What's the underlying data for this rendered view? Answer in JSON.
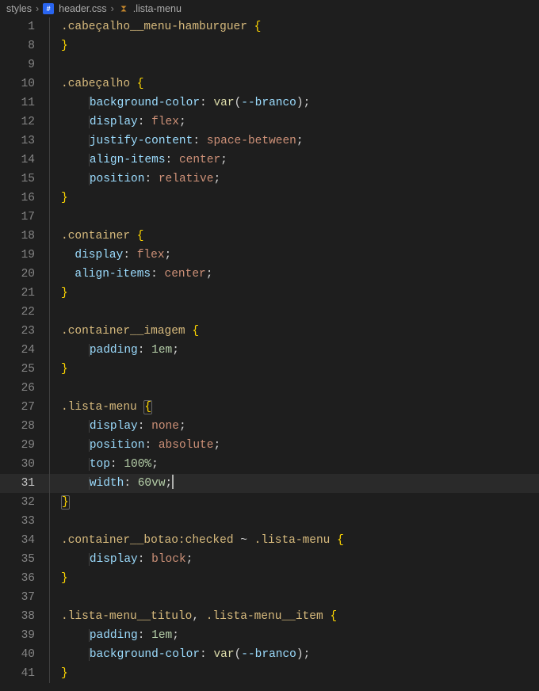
{
  "breadcrumb": {
    "folder": "styles",
    "file": "header.css",
    "symbol": ".lista-menu"
  },
  "lines": [
    {
      "num": "1",
      "indent": 0,
      "tokens": [
        [
          "sel",
          ".cabeçalho__menu-hamburguer"
        ],
        [
          "sp",
          " "
        ],
        [
          "brace",
          "{"
        ]
      ]
    },
    {
      "num": "8",
      "indent": 0,
      "tokens": [
        [
          "brace",
          "}"
        ]
      ]
    },
    {
      "num": "9",
      "indent": 0,
      "tokens": []
    },
    {
      "num": "10",
      "indent": 0,
      "tokens": [
        [
          "sel",
          ".cabeçalho"
        ],
        [
          "sp",
          " "
        ],
        [
          "brace",
          "{"
        ]
      ]
    },
    {
      "num": "11",
      "indent": 1,
      "tokens": [
        [
          "prop",
          "background-color"
        ],
        [
          "punc",
          ":"
        ],
        [
          "sp",
          " "
        ],
        [
          "func",
          "var"
        ],
        [
          "punc",
          "("
        ],
        [
          "var",
          "--branco"
        ],
        [
          "punc",
          ")"
        ],
        [
          "punc",
          ";"
        ]
      ]
    },
    {
      "num": "12",
      "indent": 1,
      "tokens": [
        [
          "prop",
          "display"
        ],
        [
          "punc",
          ":"
        ],
        [
          "sp",
          " "
        ],
        [
          "val",
          "flex"
        ],
        [
          "punc",
          ";"
        ]
      ]
    },
    {
      "num": "13",
      "indent": 1,
      "tokens": [
        [
          "prop",
          "justify-content"
        ],
        [
          "punc",
          ":"
        ],
        [
          "sp",
          " "
        ],
        [
          "val",
          "space-between"
        ],
        [
          "punc",
          ";"
        ]
      ]
    },
    {
      "num": "14",
      "indent": 1,
      "tokens": [
        [
          "prop",
          "align-items"
        ],
        [
          "punc",
          ":"
        ],
        [
          "sp",
          " "
        ],
        [
          "val",
          "center"
        ],
        [
          "punc",
          ";"
        ]
      ]
    },
    {
      "num": "15",
      "indent": 1,
      "tokens": [
        [
          "prop",
          "position"
        ],
        [
          "punc",
          ":"
        ],
        [
          "sp",
          " "
        ],
        [
          "val",
          "relative"
        ],
        [
          "punc",
          ";"
        ]
      ]
    },
    {
      "num": "16",
      "indent": 0,
      "tokens": [
        [
          "brace",
          "}"
        ]
      ]
    },
    {
      "num": "17",
      "indent": 0,
      "tokens": []
    },
    {
      "num": "18",
      "indent": 0,
      "tokens": [
        [
          "sel",
          ".container"
        ],
        [
          "sp",
          " "
        ],
        [
          "brace",
          "{"
        ]
      ]
    },
    {
      "num": "19",
      "indent": 0,
      "guide": true,
      "tokens": [
        [
          "prop",
          "display"
        ],
        [
          "punc",
          ":"
        ],
        [
          "sp",
          " "
        ],
        [
          "val",
          "flex"
        ],
        [
          "punc",
          ";"
        ]
      ]
    },
    {
      "num": "20",
      "indent": 0,
      "guide": true,
      "tokens": [
        [
          "prop",
          "align-items"
        ],
        [
          "punc",
          ":"
        ],
        [
          "sp",
          " "
        ],
        [
          "val",
          "center"
        ],
        [
          "punc",
          ";"
        ]
      ]
    },
    {
      "num": "21",
      "indent": 0,
      "tokens": [
        [
          "brace",
          "}"
        ]
      ]
    },
    {
      "num": "22",
      "indent": 0,
      "tokens": []
    },
    {
      "num": "23",
      "indent": 0,
      "tokens": [
        [
          "sel",
          ".container__imagem"
        ],
        [
          "sp",
          " "
        ],
        [
          "brace",
          "{"
        ]
      ]
    },
    {
      "num": "24",
      "indent": 1,
      "tokens": [
        [
          "prop",
          "padding"
        ],
        [
          "punc",
          ":"
        ],
        [
          "sp",
          " "
        ],
        [
          "num",
          "1em"
        ],
        [
          "punc",
          ";"
        ]
      ]
    },
    {
      "num": "25",
      "indent": 0,
      "tokens": [
        [
          "brace",
          "}"
        ]
      ]
    },
    {
      "num": "26",
      "indent": 0,
      "tokens": []
    },
    {
      "num": "27",
      "indent": 0,
      "tokens": [
        [
          "sel",
          ".lista-menu"
        ],
        [
          "sp",
          " "
        ],
        [
          "bracehl",
          "{"
        ]
      ]
    },
    {
      "num": "28",
      "indent": 1,
      "tokens": [
        [
          "prop",
          "display"
        ],
        [
          "punc",
          ":"
        ],
        [
          "sp",
          " "
        ],
        [
          "val",
          "none"
        ],
        [
          "punc",
          ";"
        ]
      ]
    },
    {
      "num": "29",
      "indent": 1,
      "tokens": [
        [
          "prop",
          "position"
        ],
        [
          "punc",
          ":"
        ],
        [
          "sp",
          " "
        ],
        [
          "val",
          "absolute"
        ],
        [
          "punc",
          ";"
        ]
      ]
    },
    {
      "num": "30",
      "indent": 1,
      "tokens": [
        [
          "prop",
          "top"
        ],
        [
          "punc",
          ":"
        ],
        [
          "sp",
          " "
        ],
        [
          "num",
          "100%"
        ],
        [
          "punc",
          ";"
        ]
      ]
    },
    {
      "num": "31",
      "indent": 1,
      "active": true,
      "tokens": [
        [
          "prop",
          "width"
        ],
        [
          "punc",
          ":"
        ],
        [
          "sp",
          " "
        ],
        [
          "num",
          "60vw"
        ],
        [
          "punc",
          ";"
        ],
        [
          "cursor",
          ""
        ]
      ]
    },
    {
      "num": "32",
      "indent": 0,
      "tokens": [
        [
          "bracehl",
          "}"
        ]
      ]
    },
    {
      "num": "33",
      "indent": 0,
      "tokens": []
    },
    {
      "num": "34",
      "indent": 0,
      "tokens": [
        [
          "sel",
          ".container__botao:checked"
        ],
        [
          "sp",
          " "
        ],
        [
          "punc",
          "~"
        ],
        [
          "sp",
          " "
        ],
        [
          "sel",
          ".lista-menu"
        ],
        [
          "sp",
          " "
        ],
        [
          "brace",
          "{"
        ]
      ]
    },
    {
      "num": "35",
      "indent": 1,
      "tokens": [
        [
          "prop",
          "display"
        ],
        [
          "punc",
          ":"
        ],
        [
          "sp",
          " "
        ],
        [
          "val",
          "block"
        ],
        [
          "punc",
          ";"
        ]
      ]
    },
    {
      "num": "36",
      "indent": 0,
      "tokens": [
        [
          "brace",
          "}"
        ]
      ]
    },
    {
      "num": "37",
      "indent": 0,
      "tokens": []
    },
    {
      "num": "38",
      "indent": 0,
      "tokens": [
        [
          "sel",
          ".lista-menu__titulo"
        ],
        [
          "punc",
          ","
        ],
        [
          "sp",
          " "
        ],
        [
          "sel",
          ".lista-menu__item"
        ],
        [
          "sp",
          " "
        ],
        [
          "brace",
          "{"
        ]
      ]
    },
    {
      "num": "39",
      "indent": 1,
      "tokens": [
        [
          "prop",
          "padding"
        ],
        [
          "punc",
          ":"
        ],
        [
          "sp",
          " "
        ],
        [
          "num",
          "1em"
        ],
        [
          "punc",
          ";"
        ]
      ]
    },
    {
      "num": "40",
      "indent": 1,
      "tokens": [
        [
          "prop",
          "background-color"
        ],
        [
          "punc",
          ":"
        ],
        [
          "sp",
          " "
        ],
        [
          "func",
          "var"
        ],
        [
          "punc",
          "("
        ],
        [
          "var",
          "--branco"
        ],
        [
          "punc",
          ")"
        ],
        [
          "punc",
          ";"
        ]
      ]
    },
    {
      "num": "41",
      "indent": 0,
      "tokens": [
        [
          "brace",
          "}"
        ]
      ]
    }
  ]
}
